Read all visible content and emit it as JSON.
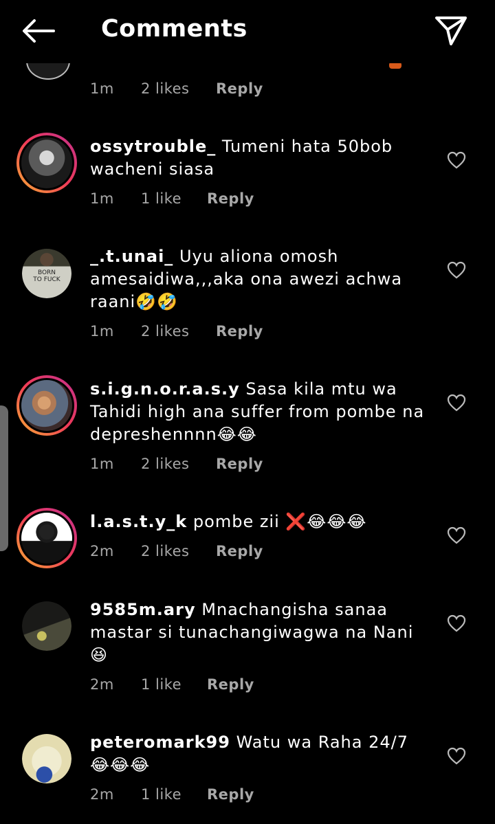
{
  "header": {
    "title": "Comments",
    "back_icon": "arrow-left-icon",
    "send_icon": "paper-plane-icon"
  },
  "partial_comment": {
    "time": "1m",
    "likes": "2 likes",
    "reply": "Reply"
  },
  "comments": [
    {
      "username": "ossytrouble_",
      "text": "Tumeni hata 50bob wacheni siasa",
      "time": "1m",
      "likes": "1 like",
      "reply": "Reply",
      "story_ring": true
    },
    {
      "username": "_.t.unai_",
      "text": "Uyu aliona omosh amesaidiwa,,,aka ona awezi achwa raani🤣🤣",
      "time": "1m",
      "likes": "2 likes",
      "reply": "Reply",
      "story_ring": false
    },
    {
      "username": "s.i.g.n.o.r.a.s.y",
      "text": "Sasa kila mtu wa Tahidi high ana suffer from pombe na depreshennnn😂😂",
      "time": "1m",
      "likes": "2 likes",
      "reply": "Reply",
      "story_ring": true
    },
    {
      "username": "l.a.s.t.y_k",
      "text": "pombe zii ❌😂😂😂",
      "time": "2m",
      "likes": "2 likes",
      "reply": "Reply",
      "story_ring": true
    },
    {
      "username": "9585m.ary",
      "text": "Mnachangisha sanaa mastar si tunachangiwagwa na Nani 😆",
      "time": "2m",
      "likes": "1 like",
      "reply": "Reply",
      "story_ring": false
    },
    {
      "username": "peteromark99",
      "text": "Watu wa Raha 24/7😂😂😂",
      "time": "2m",
      "likes": "1 like",
      "reply": "Reply",
      "story_ring": false
    }
  ],
  "avatar_shirt_text": "BORN TO FUCK",
  "colors": {
    "background": "#000000",
    "meta": "#a8a8a8",
    "ring_start": "#f8b133",
    "ring_end": "#c2308e"
  }
}
